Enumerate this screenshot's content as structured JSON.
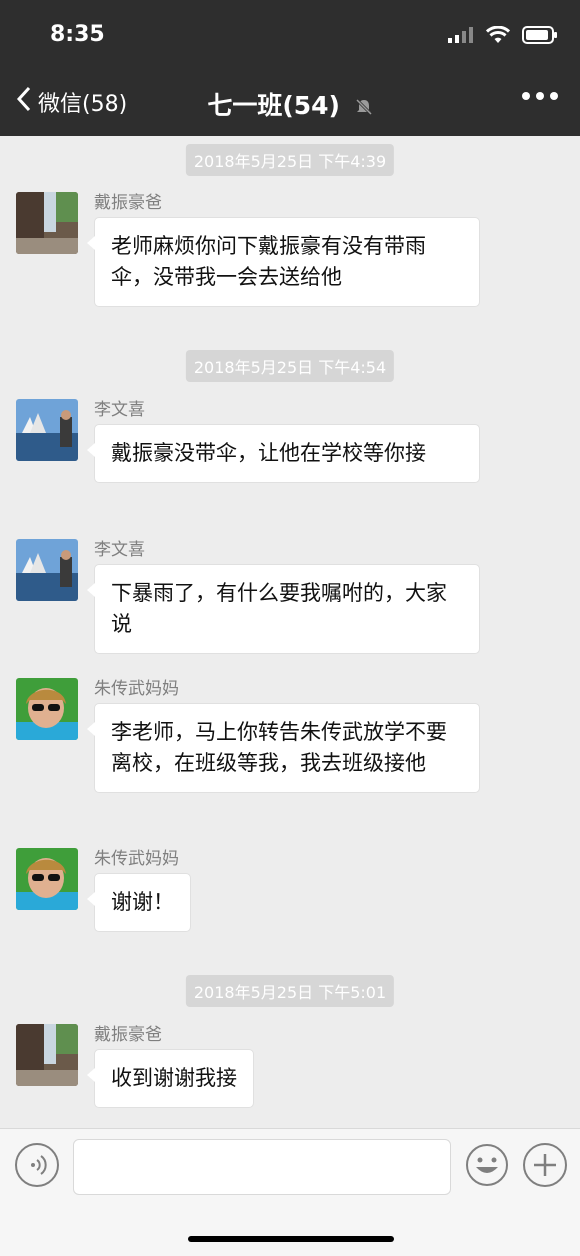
{
  "status_bar": {
    "time": "8:35",
    "icons": [
      "signal-icon",
      "wifi-icon",
      "battery-icon"
    ]
  },
  "nav": {
    "back_label": "微信(58)",
    "title": "七一班(54)",
    "mute_icon": "mute-bell-icon",
    "more_icon": "more-icon"
  },
  "timestamps": [
    "2018年5月25日 下午4:39",
    "2018年5月25日 下午4:54",
    "2018年5月25日 下午5:01"
  ],
  "messages": [
    {
      "sender": "戴振豪爸",
      "text": "老师麻烦你问下戴振豪有没有带雨伞，没带我一会去送给他"
    },
    {
      "sender": "李文喜",
      "text": "戴振豪没带伞，让他在学校等你接"
    },
    {
      "sender": "李文喜",
      "text": "下暴雨了，有什么要我嘱咐的，大家说"
    },
    {
      "sender": "朱传武妈妈",
      "text": "李老师，马上你转告朱传武放学不要离校，在班级等我，我去班级接他"
    },
    {
      "sender": "朱传武妈妈",
      "text": "谢谢！"
    },
    {
      "sender": "戴振豪爸",
      "text": "收到谢谢我接"
    }
  ],
  "input_bar": {
    "voice_icon": "voice-icon",
    "emoji_icon": "emoji-icon",
    "plus_icon": "plus-icon"
  }
}
